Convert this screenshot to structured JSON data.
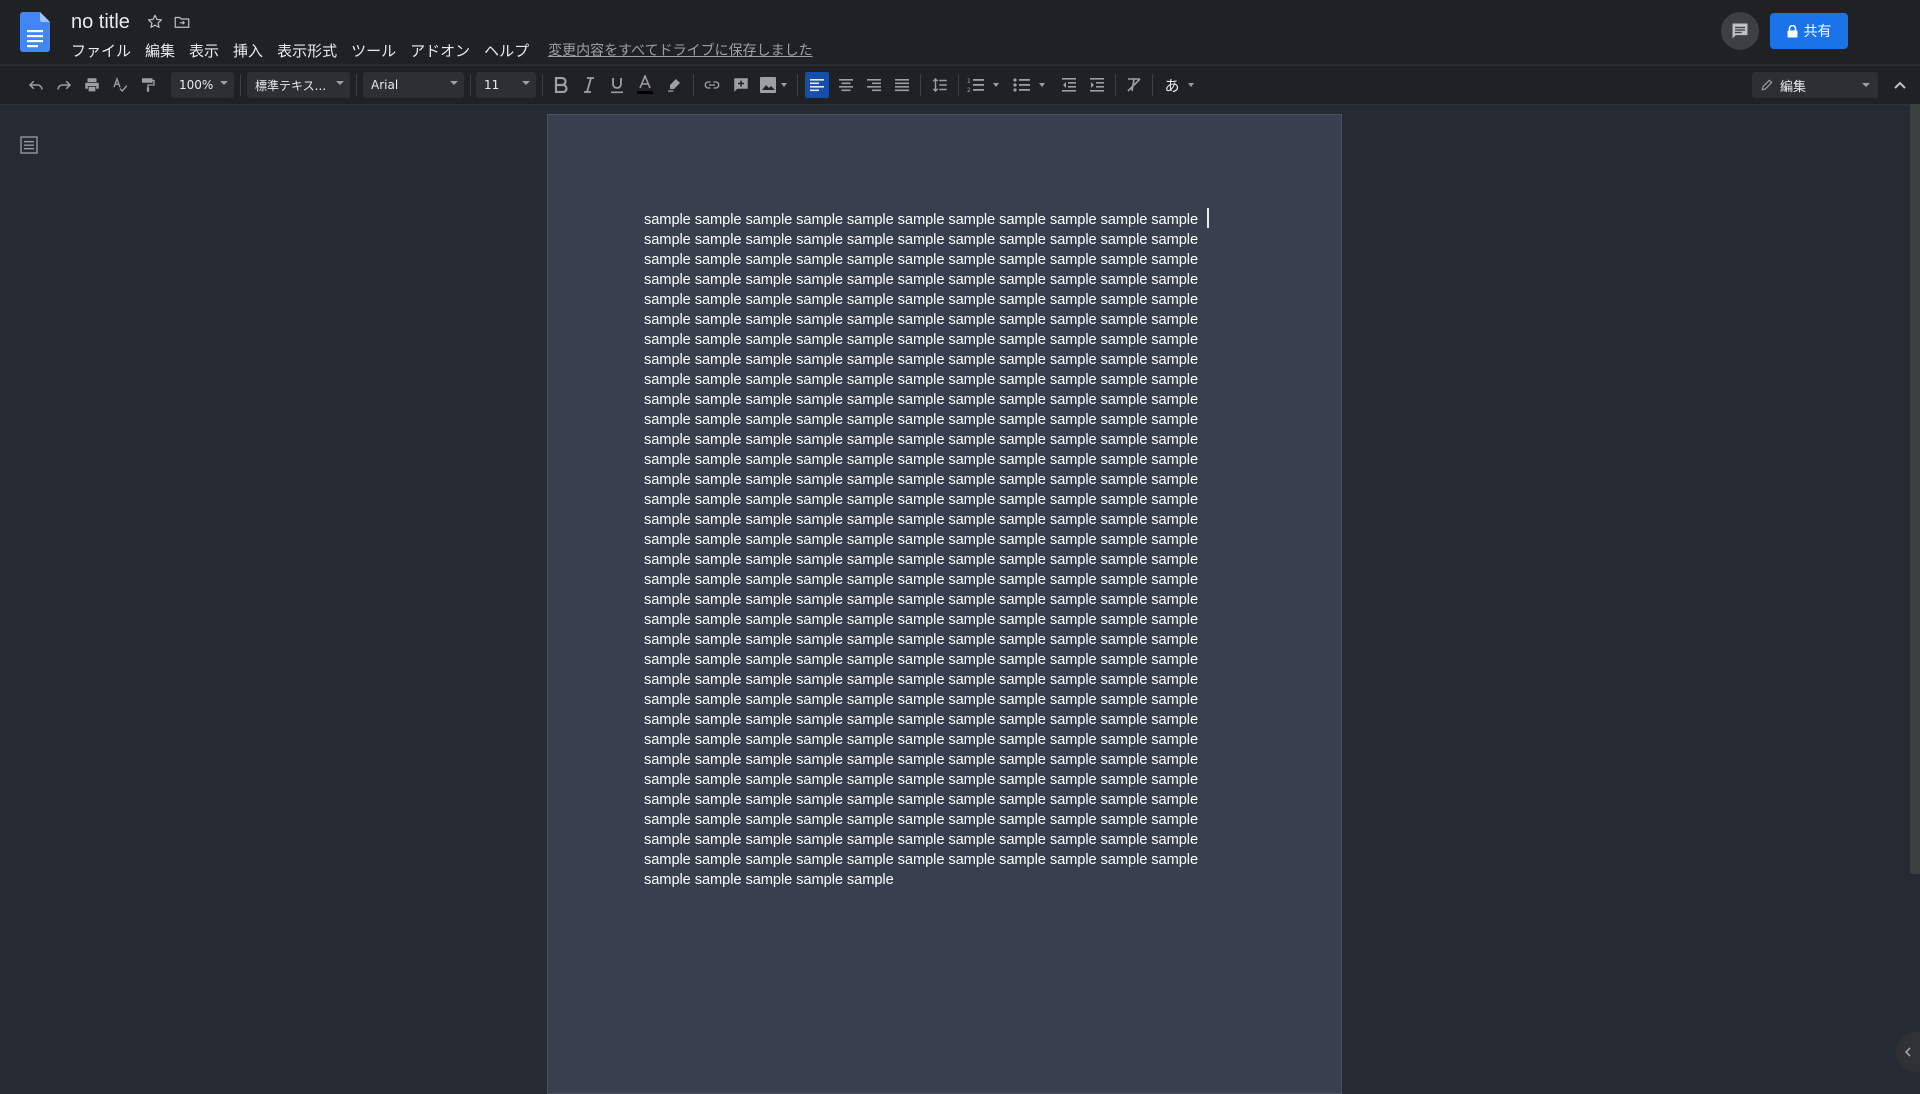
{
  "header": {
    "doc_title": "no title",
    "menu": [
      "ファイル",
      "編集",
      "表示",
      "挿入",
      "表示形式",
      "ツール",
      "アドオン",
      "ヘルプ"
    ],
    "save_status": "変更内容をすべてドライブに保存しました",
    "share_label": "共有"
  },
  "toolbar": {
    "zoom": "100%",
    "style": "標準テキス...",
    "font": "Arial",
    "font_size": "11",
    "input_tool": "あ",
    "edit_mode": "編集"
  },
  "document": {
    "body": "sample sample sample sample sample sample sample sample sample sample sample sample sample sample sample sample sample sample sample sample sample sample sample sample sample sample sample sample sample sample sample sample sample sample sample sample sample sample sample sample sample sample sample sample sample sample sample sample sample sample sample sample sample sample sample sample sample sample sample sample sample sample sample sample sample sample sample sample sample sample sample sample sample sample sample sample sample sample sample sample sample sample sample sample sample sample sample sample sample sample sample sample sample sample sample sample sample sample sample sample sample sample sample sample sample sample sample sample sample sample sample sample sample sample sample sample sample sample sample sample sample sample sample sample sample sample sample sample sample sample sample sample sample sample sample sample sample sample sample sample sample sample sample sample sample sample sample sample sample sample sample sample sample sample sample sample sample sample sample sample sample sample sample sample sample sample sample sample sample sample sample sample sample sample sample sample sample sample sample sample sample sample sample sample sample sample sample sample sample sample sample sample sample sample sample sample sample sample sample sample sample sample sample sample sample sample sample sample sample sample sample sample sample sample sample sample sample sample sample sample sample sample sample sample sample sample sample sample sample sample sample sample sample sample sample sample sample sample sample sample sample sample sample sample sample sample sample sample sample sample sample sample sample sample sample sample sample sample sample sample sample sample sample sample sample sample sample sample sample sample sample sample sample sample sample sample sample sample sample sample sample sample sample sample sample sample sample sample sample sample sample sample sample sample sample sample sample sample sample sample sample sample sample sample sample sample sample sample sample sample sample sample sample sample sample sample sample sample sample sample sample sample sample sample sample sample sample sample sample sample sample sample sample sample sample sample sample sample sample sample sample sample sample sample sample sample sample sample sample sample sample sample sample sample sample sample sample sample sample sample sample sample sample sample sample sample sample sample"
  },
  "icons": {
    "app": "google-docs-icon",
    "star": "star-icon",
    "move": "folder-move-icon",
    "comment": "comment-icon",
    "lock": "lock-icon",
    "outline": "document-outline-icon"
  },
  "colors": {
    "app_bar": "#202124",
    "workspace": "#262a33",
    "page": "#384050",
    "share_button": "#1a73e8",
    "docs_blue": "#4285f4"
  }
}
